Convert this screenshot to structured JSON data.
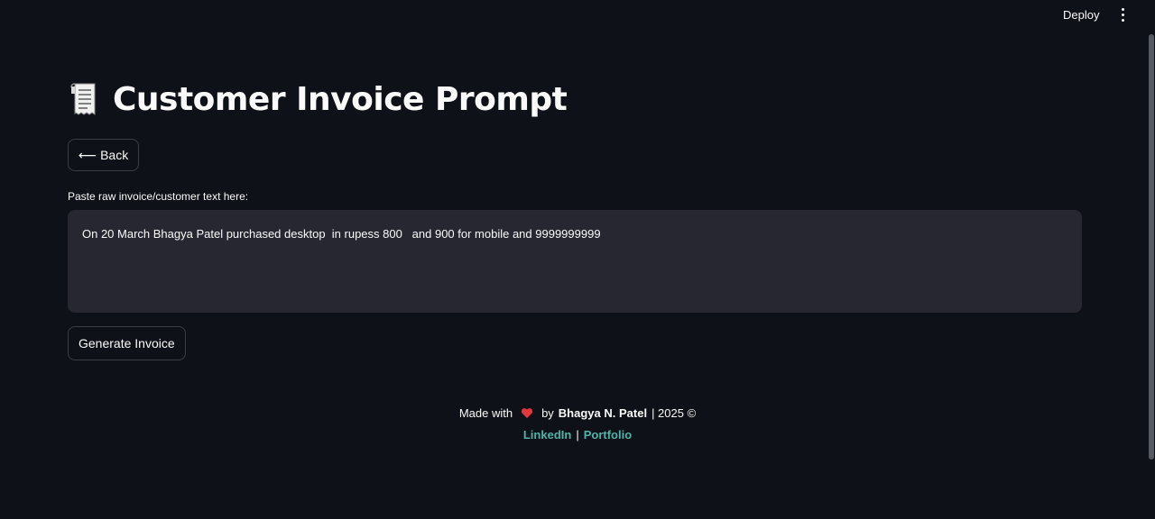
{
  "header": {
    "deploy_label": "Deploy",
    "menu_icon": "kebab-menu-icon"
  },
  "page": {
    "title": "Customer Invoice Prompt",
    "title_icon": "receipt-icon"
  },
  "back_button": {
    "icon": "left-arrow-icon",
    "label": "Back"
  },
  "invoice_input": {
    "label": "Paste raw invoice/customer text here:",
    "value": "On 20 March Bhagya Patel purchased desktop  in rupess 800   and 900 for mobile and 9999999999"
  },
  "generate_button": {
    "label": "Generate Invoice"
  },
  "footer": {
    "made_with": "Made with",
    "heart_icon": "heart-icon",
    "by": "by",
    "author": "Bhagya N. Patel",
    "year_text": "| 2025 ©",
    "links": [
      {
        "label": "LinkedIn"
      },
      {
        "label": "Portfolio"
      }
    ],
    "link_separator": "|"
  },
  "colors": {
    "background": "#0e1117",
    "input_background": "#262730",
    "link": "#4fb3a9",
    "heart": "#e0383e"
  }
}
